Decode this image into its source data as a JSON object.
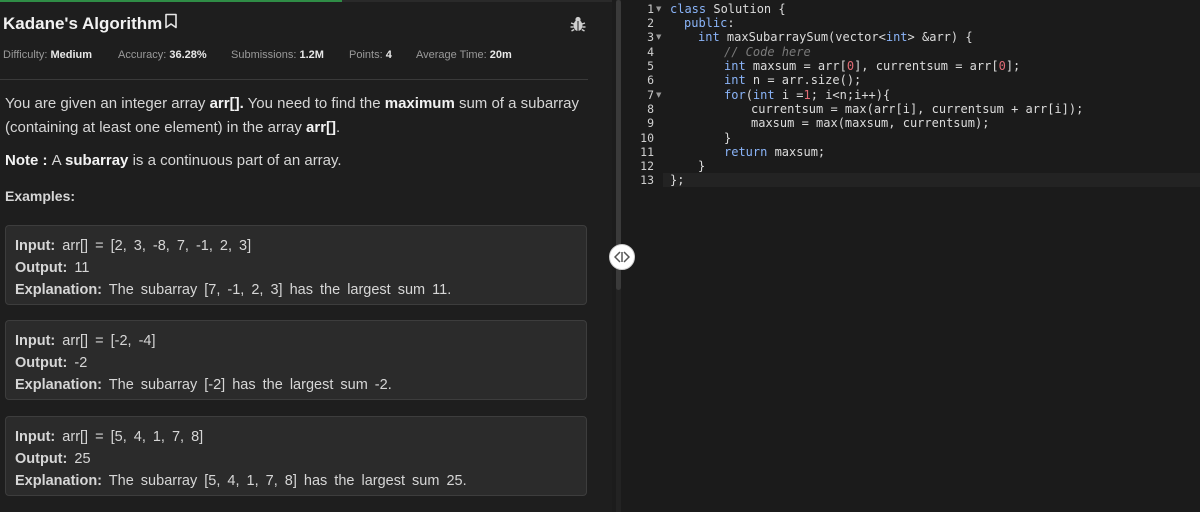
{
  "problem": {
    "title": "Kadane's Algorithm",
    "meta": [
      {
        "label": "Difficulty:",
        "value": "Medium"
      },
      {
        "label": "Accuracy:",
        "value": "36.28%"
      },
      {
        "label": "Submissions:",
        "value": "1.2M"
      },
      {
        "label": "Points:",
        "value": "4"
      },
      {
        "label": "Average Time:",
        "value": "20m"
      }
    ],
    "description": {
      "p1_a": "You are given an integer array ",
      "p1_b": "arr[].",
      "p1_c": " You need to find the ",
      "p1_d": "maximum",
      "p1_e": " sum of a subarray",
      "p1_f": "(containing at least one element) in the array ",
      "p1_g": "arr[]",
      "p1_h": ".",
      "note_label": "Note : ",
      "note_a": "A ",
      "note_b": "subarray",
      "note_c": " is a continuous part of an array."
    },
    "examples_heading": "Examples:",
    "examples": [
      {
        "input_label": "Input:",
        "input": "arr[]  =  [2, 3, -8, 7, -1, 2, 3]",
        "output_label": "Output:",
        "output": "11",
        "explanation_label": "Explanation:",
        "explanation": "The subarray [7, -1, 2, 3] has the largest sum 11."
      },
      {
        "input_label": "Input:",
        "input": "arr[]  =  [-2, -4]",
        "output_label": "Output:",
        "output": "-2",
        "explanation_label": "Explanation:",
        "explanation": "The subarray [-2] has the largest sum -2."
      },
      {
        "input_label": "Input:",
        "input": "arr[]  =  [5, 4, 1, 7, 8]",
        "output_label": "Output:",
        "output": "25",
        "explanation_label": "Explanation:",
        "explanation": "The subarray [5, 4, 1, 7, 8] has the largest sum 25."
      }
    ]
  },
  "editor": {
    "line_numbers": [
      "1",
      "2",
      "3",
      "4",
      "5",
      "6",
      "7",
      "8",
      "9",
      "10",
      "11",
      "12",
      "13"
    ],
    "lines": {
      "l1_kw": "class",
      "l1_rest": " Solution {",
      "l2_kw": "public",
      "l2_rest": ":",
      "l3_kw": "int",
      "l3_rest": " maxSubarraySum(vector<",
      "l3_kw2": "int",
      "l3_rest2": "> &arr) {",
      "l4_cm": "// Code here",
      "l5_kw": "int",
      "l5_a": " maxsum = arr[",
      "l5_n1": "0",
      "l5_b": "], currentsum = arr[",
      "l5_n2": "0",
      "l5_c": "];",
      "l6_kw": "int",
      "l6_rest": " n = arr.size();",
      "l7_kw": "for",
      "l7_a": "(",
      "l7_kw2": "int",
      "l7_b": " i =",
      "l7_n": "1",
      "l7_c": "; i<n;i++){",
      "l8": "currentsum = max(arr[i], currentsum + arr[i]);",
      "l9": "maxsum = max(maxsum, currentsum);",
      "l10": "}",
      "l11_kw": "return",
      "l11_rest": " maxsum;",
      "l12": "}",
      "l13": "};"
    }
  },
  "colors": {
    "accent": "#2f8d46",
    "keyword": "#8ab4f8",
    "number": "#e06c75",
    "comment": "#7a7a7a"
  }
}
